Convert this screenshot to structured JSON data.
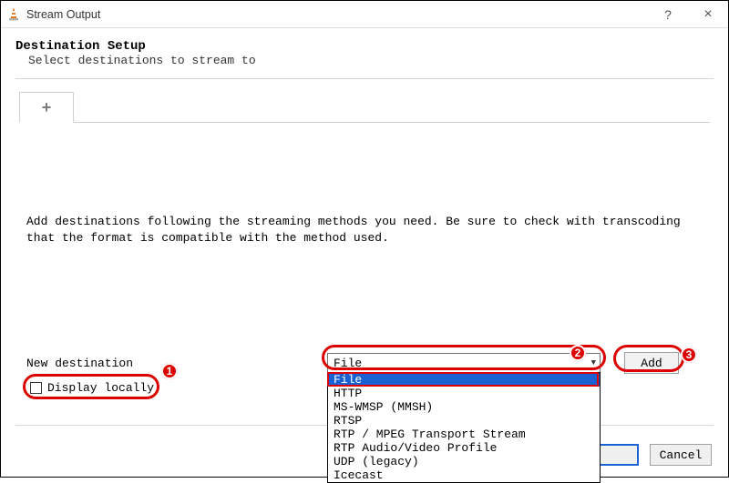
{
  "window": {
    "title": "Stream Output",
    "help_tooltip": "?",
    "close_tooltip": "×"
  },
  "header": {
    "title": "Destination Setup",
    "subtitle": "Select destinations to stream to"
  },
  "tab": {
    "add_label": "+"
  },
  "body": {
    "instructions": "Add destinations following the streaming methods you need. Be sure to check with transcoding that the format is compatible with the method used."
  },
  "destination": {
    "label": "New destination",
    "selected": "File",
    "options": [
      "File",
      "HTTP",
      "MS-WMSP (MMSH)",
      "RTSP",
      "RTP / MPEG Transport Stream",
      "RTP Audio/Video Profile",
      "UDP (legacy)",
      "Icecast"
    ],
    "add_button": "Add"
  },
  "display_locally": {
    "label": "Display locally",
    "checked": false
  },
  "footer": {
    "cancel": "Cancel"
  },
  "annotations": {
    "n1": "1",
    "n2": "2",
    "n3": "3"
  }
}
